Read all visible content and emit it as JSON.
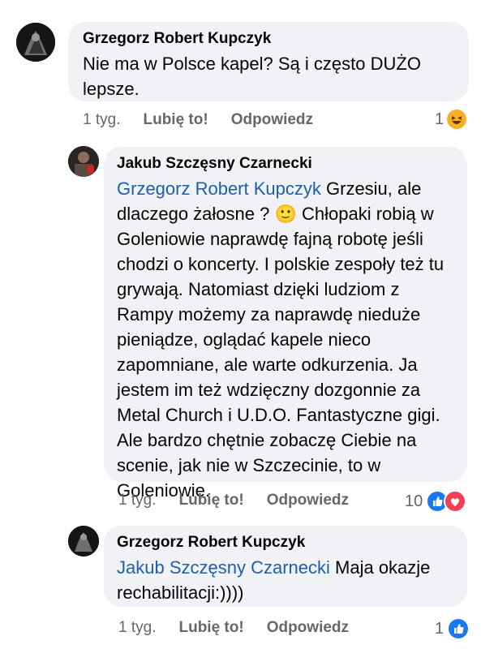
{
  "comments": [
    {
      "author": "Grzegorz Robert Kupczyk",
      "mention": "",
      "text": "Nie ma w Polsce kapel? Są i często DUŻO lepsze.",
      "time": "1 tyg.",
      "like_label": "Lubię to!",
      "reply_label": "Odpowiedz",
      "reaction_count": "1",
      "reactions": [
        "haha"
      ]
    },
    {
      "author": "Jakub Szczęsny Czarnecki",
      "mention": "Grzegorz Robert Kupczyk",
      "text": "Grzesiu, ale dlaczego żałosne ? 🙂 Chłopaki robią w Goleniowie naprawdę fajną robotę jeśli chodzi o koncerty. I polskie zespoły też tu grywają. Natomiast dzięki ludziom z Rampy możemy za naprawdę nieduże pieniądze, oglądać kapele nieco zapomniane, ale warte odkurzenia. Ja jestem im też wdzięczny dozgonnie za Metal Church i U.D.O. Fantastyczne gigi. Ale bardzo chętnie zobaczę Ciebie na scenie, jak nie w Szczecinie, to w Goleniowie.",
      "time": "1 tyg.",
      "like_label": "Lubię to!",
      "reply_label": "Odpowiedz",
      "reaction_count": "10",
      "reactions": [
        "like",
        "love"
      ]
    },
    {
      "author": "Grzegorz Robert Kupczyk",
      "mention": "Jakub Szczęsny Czarnecki",
      "text": "Maja okazje rechabilitacji:))))",
      "time": "1 tyg.",
      "like_label": "Lubię to!",
      "reply_label": "Odpowiedz",
      "reaction_count": "1",
      "reactions": [
        "like"
      ]
    }
  ],
  "colors": {
    "bubble": "#f0f2f5",
    "mention": "#1e5fa8",
    "like": "#1877f2",
    "love": "#f33e58",
    "haha": "#f7b125",
    "meta": "#65676b"
  }
}
